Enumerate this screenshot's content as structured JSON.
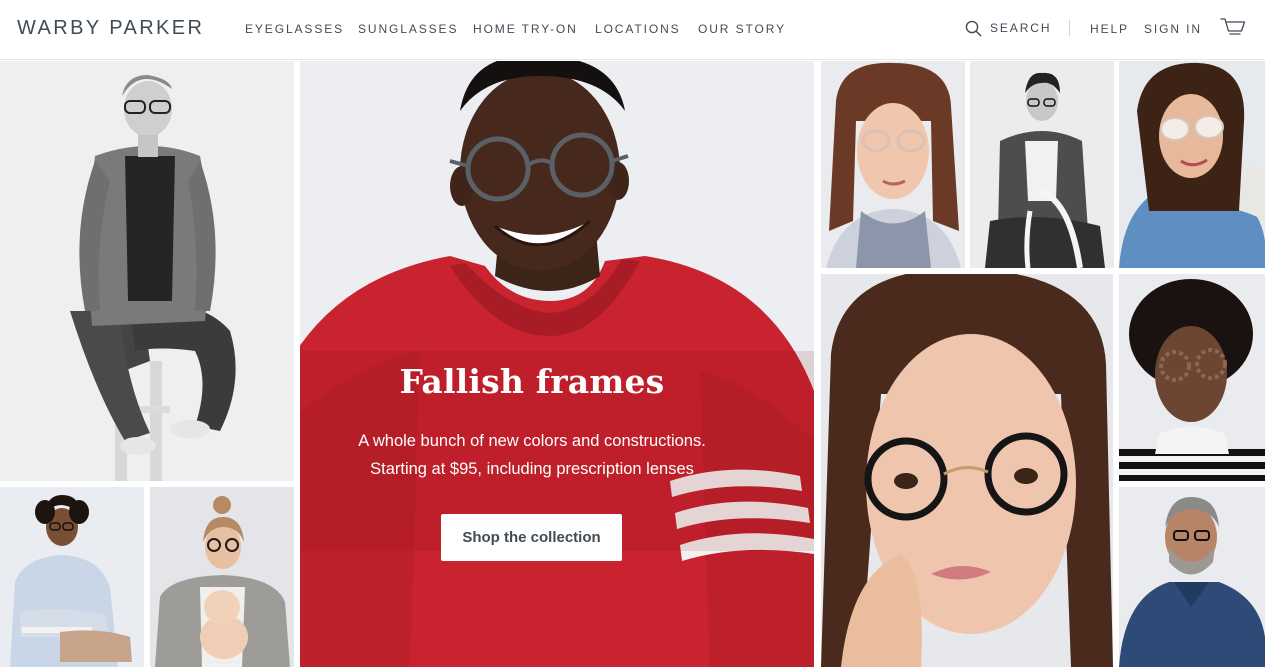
{
  "brand": {
    "logo_text": "WARBY PARKER"
  },
  "nav": {
    "eyeglasses": "EYEGLASSES",
    "sunglasses": "SUNGLASSES",
    "home_try_on": "HOME TRY-ON",
    "locations": "LOCATIONS",
    "our_story": "OUR STORY"
  },
  "utility": {
    "search": "SEARCH",
    "search_icon": "search-icon",
    "help": "HELP",
    "sign_in": "SIGN IN",
    "cart_icon": "cart-icon"
  },
  "hero": {
    "title": "Fallish frames",
    "subtitle_line1": "A whole bunch of new colors and constructions.",
    "subtitle_line2": "Starting at $95, including prescription lenses",
    "cta_label": "Shop the collection",
    "sweater_color": "#c8232e"
  },
  "colors": {
    "text": "#414b56",
    "background": "#ffffff",
    "backdrop": "#eceef1"
  }
}
